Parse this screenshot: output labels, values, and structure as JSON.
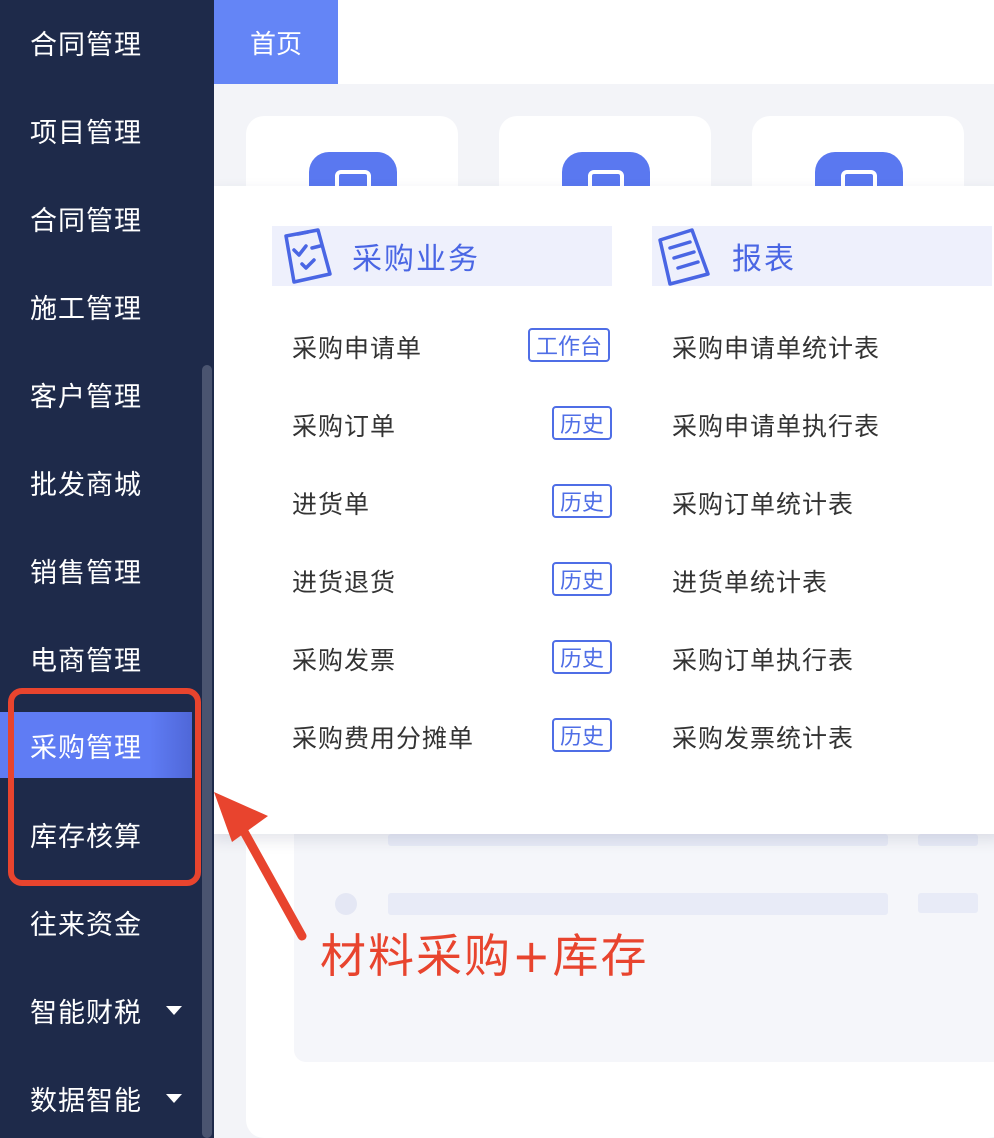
{
  "sidebar": {
    "items": [
      {
        "label": "合同管理"
      },
      {
        "label": "项目管理"
      },
      {
        "label": "合同管理"
      },
      {
        "label": "施工管理"
      },
      {
        "label": "客户管理"
      },
      {
        "label": "批发商城"
      },
      {
        "label": "销售管理"
      },
      {
        "label": "电商管理"
      },
      {
        "label": "采购管理",
        "active": true
      },
      {
        "label": "库存核算"
      },
      {
        "label": "往来资金"
      },
      {
        "label": "智能财税",
        "has_submenu": true
      },
      {
        "label": "数据智能",
        "has_submenu": true
      }
    ]
  },
  "tabs": {
    "home": "首页"
  },
  "popup": {
    "business": {
      "title": "采购业务",
      "icon": "clipboard-check-icon",
      "items": [
        {
          "label": "采购申请单",
          "tag": "工作台"
        },
        {
          "label": "采购订单",
          "tag": "历史"
        },
        {
          "label": "进货单",
          "tag": "历史"
        },
        {
          "label": "进货退货",
          "tag": "历史"
        },
        {
          "label": "采购发票",
          "tag": "历史"
        },
        {
          "label": "采购费用分摊单",
          "tag": "历史"
        }
      ]
    },
    "reports": {
      "title": "报表",
      "icon": "report-document-icon",
      "items": [
        {
          "label": "采购申请单统计表"
        },
        {
          "label": "采购申请单执行表"
        },
        {
          "label": "采购订单统计表"
        },
        {
          "label": "进货单统计表"
        },
        {
          "label": "采购订单执行表"
        },
        {
          "label": "采购发票统计表"
        }
      ]
    }
  },
  "annotation": {
    "text": "材料采购+库存",
    "color": "#e8442e"
  },
  "colors": {
    "sidebar_bg": "#1e2a4a",
    "accent": "#5f7cf4",
    "tag_border": "#4f6ee6"
  }
}
